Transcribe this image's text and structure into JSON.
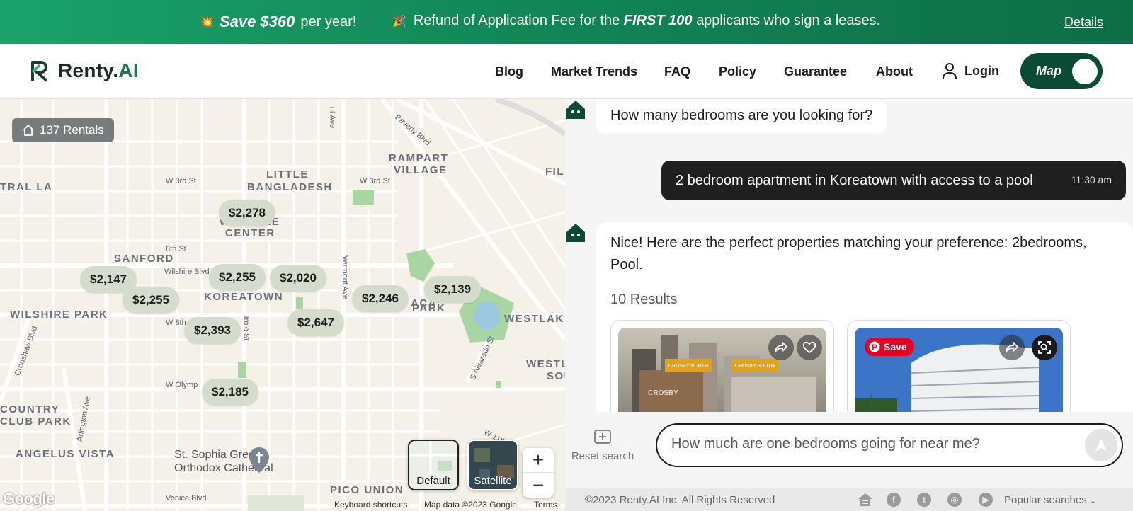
{
  "promo": {
    "save_amount": "Save $360",
    "save_suffix": "per year!",
    "refund_prefix": "Refund of Application Fee for the",
    "refund_bold": "FIRST 100",
    "refund_suffix": "applicants who sign a leases.",
    "details": "Details"
  },
  "header": {
    "logo_main": "Renty.",
    "logo_ai": "AI",
    "nav": [
      "Blog",
      "Market Trends",
      "FAQ",
      "Policy",
      "Guarantee",
      "About"
    ],
    "login": "Login",
    "map_toggle": "Map"
  },
  "map": {
    "rentals_badge": "137 Rentals",
    "pins": [
      "$2,278",
      "$2,147",
      "$2,255",
      "$2,020",
      "$2,255",
      "$2,246",
      "$2,139",
      "$2,393",
      "$2,647",
      "$2,185"
    ],
    "labels": {
      "little_bangladesh_1": "LITTLE",
      "little_bangladesh_2": "BANGLADESH",
      "rampart_1": "RAMPART",
      "rampart_2": "VILLAGE",
      "wilshire_center_1": "WILSHIRE",
      "wilshire_center_2": "CENTER",
      "sanford": "SANFORD",
      "koreatown": "KOREATOWN",
      "wilshire_park": "WILSHIRE PARK",
      "westlake": "WESTLAK",
      "westlake_south_1": "WESTL",
      "westlake_south_2": "SOU",
      "country_club_1": "COUNTRY",
      "country_club_2": "CLUB PARK",
      "angelus_vista": "ANGELUS VISTA",
      "pico_union": "PICO UNION",
      "tral_la": "TRAL LA",
      "fil": "FIL",
      "park_1": "ACA",
      "park_2": "PARK"
    },
    "streets": {
      "w3rd_a": "W 3rd St",
      "w3rd_b": "W 3rd St",
      "w6th": "6th St",
      "wilshire_blvd": "Wilshire Blvd",
      "w8th": "W 8th",
      "w_olympic": "W Olymp",
      "beverly": "Beverly Blvd",
      "vermont": "Vermont Ave",
      "normandie": "nt Ave",
      "iriolo": "Irolo St",
      "alvarado": "S Alvarado St",
      "crenshaw": "Crenshaw Blvd",
      "arlington": "Arlington Ave",
      "w11th": "W 11th",
      "venice": "Venice Blvd"
    },
    "church": "St. Sophia Greek Orthodox Cathedral",
    "church_1": "St. Sophia Greek",
    "church_2": "Orthodox Cathedral",
    "map_type_default": "Default",
    "map_type_satellite": "Satellite",
    "zoom_in": "+",
    "zoom_out": "−",
    "google": "Google",
    "keyboard_shortcuts": "Keyboard shortcuts",
    "map_data": "Map data ©2023 Google",
    "terms": "Terms"
  },
  "chat": {
    "bot_question": "How many bedrooms are you looking for?",
    "user_message": "2 bedroom apartment in Koreatown with access to a pool",
    "user_time": "11:30 am",
    "bot_response": "Nice! Here are the perfect properties matching your preference: 2bedrooms, Pool.",
    "results_count": "10 Results",
    "card1_signs": [
      "CROSBY NORTH",
      "CROSBY SOUTH"
    ],
    "card1_building": "CROSBY",
    "card2_save": "Save"
  },
  "input": {
    "reset_label": "Reset search",
    "placeholder": "How much are one bedrooms going for near me?"
  },
  "footer": {
    "copyright": "©2023 Renty.AI Inc. All Rights Reserved",
    "popular": "Popular searches"
  },
  "colors": {
    "brand_green": "#0b4a33",
    "promo_green": "#118555",
    "accent_green": "#1b7a52"
  }
}
